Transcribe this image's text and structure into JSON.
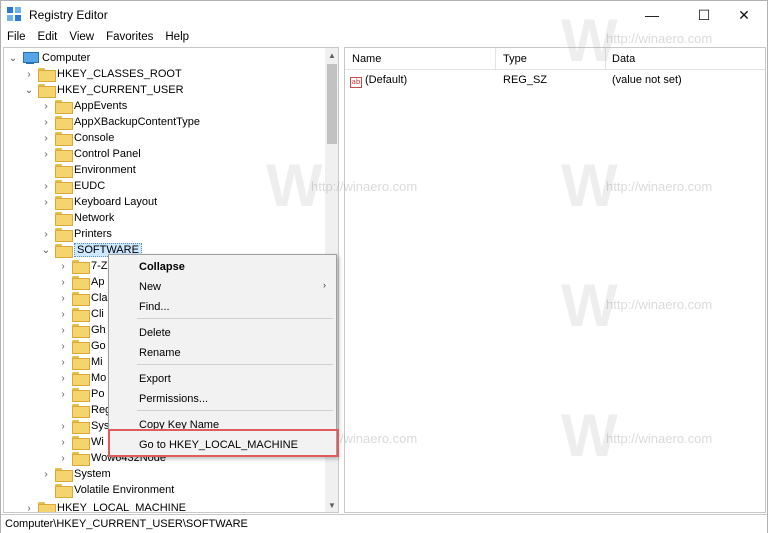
{
  "window": {
    "title": "Registry Editor",
    "controls": {
      "minimize": "—",
      "maximize": "☐",
      "close": "✕"
    }
  },
  "menu": [
    "File",
    "Edit",
    "View",
    "Favorites",
    "Help"
  ],
  "tree": {
    "root": "Computer",
    "items": [
      {
        "label": "HKEY_CLASSES_ROOT"
      },
      {
        "label": "HKEY_CURRENT_USER"
      },
      {
        "label": "AppEvents"
      },
      {
        "label": "AppXBackupContentType"
      },
      {
        "label": "Console"
      },
      {
        "label": "Control Panel"
      },
      {
        "label": "Environment"
      },
      {
        "label": "EUDC"
      },
      {
        "label": "Keyboard Layout"
      },
      {
        "label": "Network"
      },
      {
        "label": "Printers"
      },
      {
        "label": "SOFTWARE"
      },
      {
        "label": "7-Z"
      },
      {
        "label": "Ap"
      },
      {
        "label": "Cla"
      },
      {
        "label": "Cli"
      },
      {
        "label": "Gh"
      },
      {
        "label": "Go"
      },
      {
        "label": "Mi"
      },
      {
        "label": "Mo"
      },
      {
        "label": "Po"
      },
      {
        "label": "Reg"
      },
      {
        "label": "Sys"
      },
      {
        "label": "Wi"
      },
      {
        "label": "Wow6432Node"
      },
      {
        "label": "System"
      },
      {
        "label": "Volatile Environment"
      },
      {
        "label": "HKEY_LOCAL_MACHINE"
      }
    ]
  },
  "list": {
    "columns": [
      "Name",
      "Type",
      "Data"
    ],
    "rows": [
      {
        "icon": "ab",
        "name": "(Default)",
        "type": "REG_SZ",
        "data": "(value not set)"
      }
    ]
  },
  "context_menu": {
    "items": [
      {
        "label": "Collapse",
        "bold": true
      },
      {
        "label": "New",
        "submenu": true
      },
      {
        "label": "Find..."
      },
      {
        "label": "Delete"
      },
      {
        "label": "Rename"
      },
      {
        "label": "Export"
      },
      {
        "label": "Permissions..."
      },
      {
        "label": "Copy Key Name"
      },
      {
        "label": "Go to HKEY_LOCAL_MACHINE"
      }
    ],
    "highlight_color": "#e05c5c"
  },
  "status": "Computer\\HKEY_CURRENT_USER\\SOFTWARE",
  "watermark": {
    "text": "http://winaero.com",
    "letter": "W"
  },
  "colors": {
    "selection": "#cde8ff",
    "folder": "#f5d36f",
    "highlight": "#e05c5c"
  }
}
